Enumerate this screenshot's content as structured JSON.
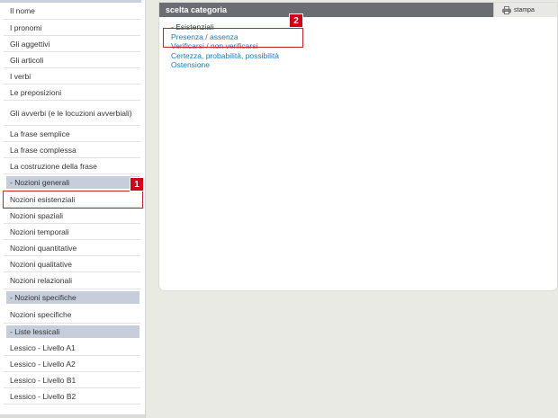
{
  "sidebar": {
    "items_top": [
      "Il nome",
      "I pronomi",
      "Gli aggettivi",
      "Gli articoli",
      "I verbi",
      "Le preposizioni",
      "Gli avverbi (e le locuzioni avverbiali)",
      "La frase semplice",
      "La frase complessa",
      "La costruzione della frase"
    ],
    "header_general": "- Nozioni generali",
    "items_general": [
      "Nozioni esistenziali",
      "Nozioni spaziali",
      "Nozioni temporali",
      "Nozioni quantitative",
      "Nozioni qualitative",
      "Nozioni relazionali"
    ],
    "header_specific": "- Nozioni specifiche",
    "items_specific": [
      "Nozioni specifiche"
    ],
    "header_lists": "- Liste lessicali",
    "items_lists": [
      "Lessico - Livello A1",
      "Lessico - Livello A2",
      "Lessico - Livello B1",
      "Lessico - Livello B2"
    ]
  },
  "panel": {
    "title": "scelta categoria",
    "print_label": "stampa",
    "options": [
      {
        "label": "- Esistenziali",
        "link": false
      },
      {
        "label": "Presenza / assenza",
        "link": true
      },
      {
        "label": "Verificarsi / non verificarsi",
        "link": true
      },
      {
        "label": "Certezza, probabilità, possibilità",
        "link": true
      },
      {
        "label": "Ostensione",
        "link": true
      }
    ]
  },
  "badges": {
    "one": "1",
    "two": "2"
  },
  "colors": {
    "header_bg": "#6a6e73",
    "section_bg": "#c6cedb",
    "link": "#1a7bc0",
    "highlight": "#c7222a",
    "badge": "#d0021b"
  }
}
